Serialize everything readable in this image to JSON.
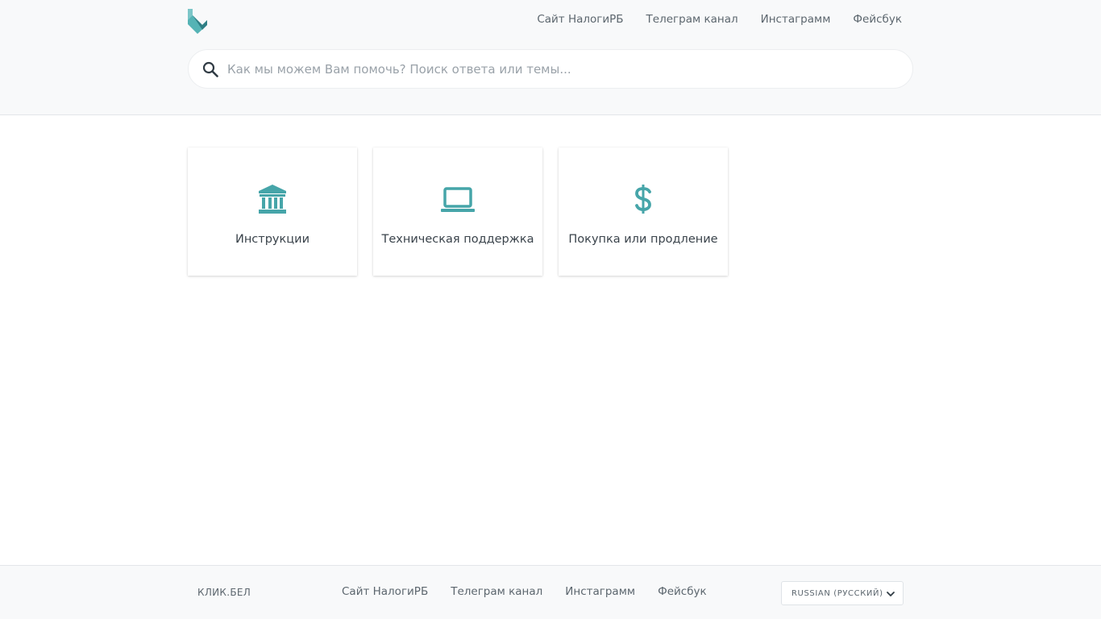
{
  "header": {
    "nav": [
      {
        "label": "Сайт НалогиРБ"
      },
      {
        "label": "Телеграм канал"
      },
      {
        "label": "Инстаграмм"
      },
      {
        "label": "Фейсбук"
      }
    ],
    "search": {
      "placeholder": "Как мы можем Вам помочь? Поиск ответа или темы...",
      "icon": "search-icon"
    }
  },
  "categories": [
    {
      "label": "Инструкции",
      "icon": "bank-icon"
    },
    {
      "label": "Техническая поддержка",
      "icon": "laptop-icon"
    },
    {
      "label": "Покупка или продление",
      "icon": "dollar-icon"
    }
  ],
  "footer": {
    "brand": "КЛИК.БЕЛ",
    "nav": [
      {
        "label": "Сайт НалогиРБ"
      },
      {
        "label": "Телеграм канал"
      },
      {
        "label": "Инстаграмм"
      },
      {
        "label": "Фейсбук"
      }
    ],
    "language": {
      "selected": "RUSSIAN (РУССКИЙ)",
      "icon": "chevron-down-icon"
    }
  },
  "colors": {
    "accent": "#46a5a9",
    "header_bg": "#f8f9fa",
    "text": "#303b44"
  }
}
